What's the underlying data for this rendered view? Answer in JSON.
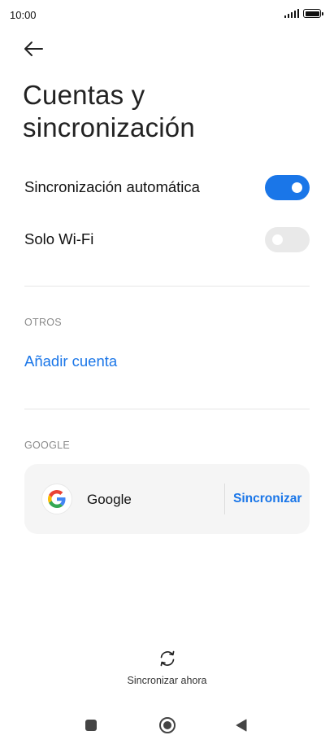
{
  "status_bar": {
    "time": "10:00",
    "signal_icon": "signal-icon",
    "battery_icon": "battery-icon"
  },
  "header": {
    "back_icon": "arrow-left-icon",
    "title_line1": "Cuentas y",
    "title_line2": "sincronización"
  },
  "settings": {
    "auto_sync": {
      "label": "Sincronización automática",
      "enabled": true
    },
    "wifi_only": {
      "label": "Solo Wi-Fi",
      "enabled": false
    }
  },
  "others": {
    "header": "OTROS",
    "add_account": "Añadir cuenta"
  },
  "google": {
    "header": "GOOGLE",
    "account_name": "Google",
    "sync_action": "Sincronizar",
    "logo_icon": "google-logo-icon"
  },
  "footer": {
    "sync_now_label": "Sincronizar ahora",
    "sync_icon": "sync-icon"
  },
  "nav": {
    "recents_icon": "square-icon",
    "home_icon": "circle-icon",
    "back_icon": "triangle-back-icon"
  },
  "colors": {
    "accent": "#1a76e8",
    "toggle_off": "#e9e9e9",
    "card_bg": "#f5f5f5"
  }
}
